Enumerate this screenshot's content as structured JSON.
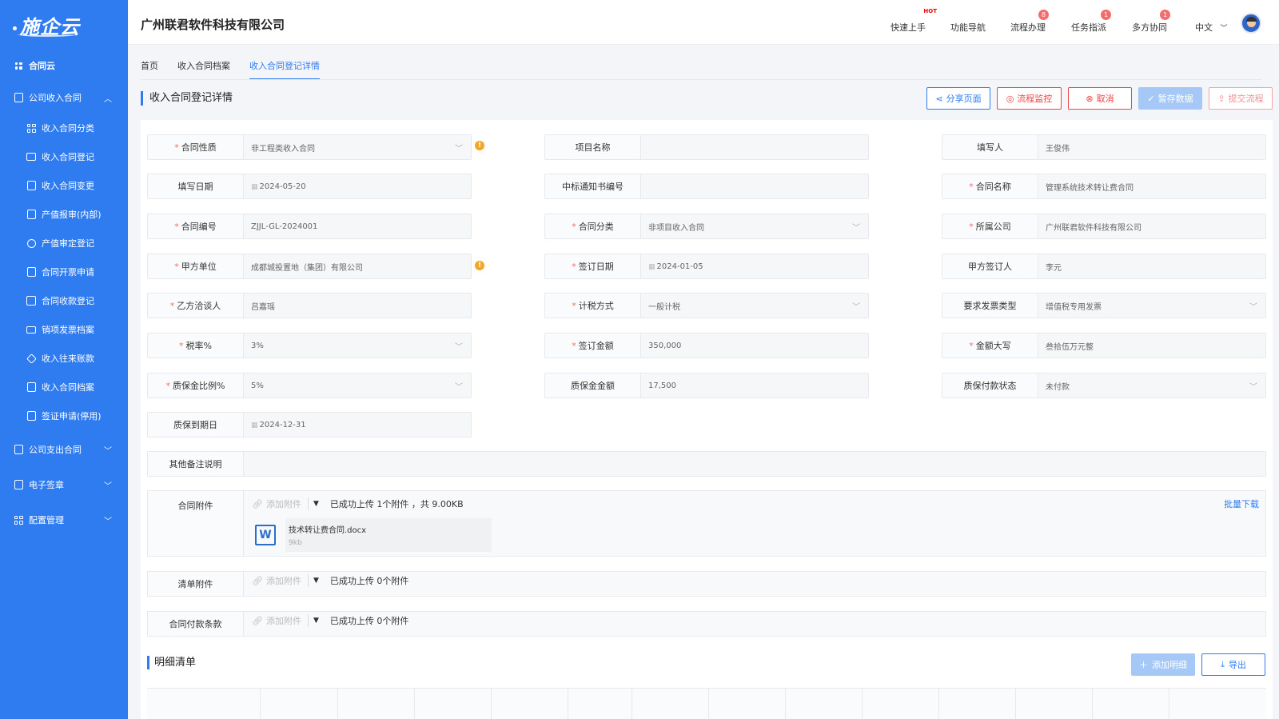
{
  "app": {
    "logo": "施企云",
    "company": "广州联君软件科技有限公司"
  },
  "sidebar": {
    "home": "合同云",
    "group1": "公司收入合同",
    "items": [
      {
        "label": "收入合同分类",
        "icon": "grid-icon"
      },
      {
        "label": "收入合同登记",
        "icon": "card-icon"
      },
      {
        "label": "收入合同变更",
        "icon": "doc-edit-icon"
      },
      {
        "label": "产值报审(内部)",
        "icon": "edit-icon"
      },
      {
        "label": "产值审定登记",
        "icon": "coin-icon"
      },
      {
        "label": "合同开票申请",
        "icon": "clipboard-icon"
      },
      {
        "label": "合同收款登记",
        "icon": "calendar-icon"
      },
      {
        "label": "销项发票档案",
        "icon": "ticket-icon"
      },
      {
        "label": "收入往来账款",
        "icon": "cube-icon"
      },
      {
        "label": "收入合同档案",
        "icon": "doc-icon"
      },
      {
        "label": "签证申请(停用)",
        "icon": "doc-edit-icon"
      }
    ],
    "group2": "公司支出合同",
    "group3": "电子签章",
    "group4": "配置管理"
  },
  "header": {
    "nav": [
      "快速上手",
      "功能导航",
      "流程办理",
      "任务指派",
      "多方协同"
    ],
    "hot": "HOT",
    "badges": {
      "flow": "8",
      "task": "1",
      "collab": "1"
    },
    "lang": "中文"
  },
  "tabs": [
    "首页",
    "收入合同档案",
    "收入合同登记详情"
  ],
  "page": {
    "title": "收入合同登记详情",
    "buttons": {
      "share": "分享页面",
      "monitor": "流程监控",
      "cancel": "取消",
      "save": "暂存数据",
      "submit": "提交流程"
    }
  },
  "form": {
    "f1": {
      "label": "合同性质",
      "value": "非工程类收入合同"
    },
    "f2": {
      "label": "项目名称",
      "value": ""
    },
    "f3": {
      "label": "填写人",
      "value": "王俊伟"
    },
    "f4": {
      "label": "填写日期",
      "value": "2024-05-20"
    },
    "f5": {
      "label": "中标通知书编号",
      "value": ""
    },
    "f6": {
      "label": "合同名称",
      "value": "管理系统技术转让费合同"
    },
    "f7": {
      "label": "合同编号",
      "value": "ZJJL-GL-2024001"
    },
    "f8": {
      "label": "合同分类",
      "value": "非项目收入合同"
    },
    "f9": {
      "label": "所属公司",
      "value": "广州联君软件科技有限公司"
    },
    "f10": {
      "label": "甲方单位",
      "value": "成都城投置地（集团）有限公司"
    },
    "f11": {
      "label": "签订日期",
      "value": "2024-01-05"
    },
    "f12": {
      "label": "甲方签订人",
      "value": "李元"
    },
    "f13": {
      "label": "乙方洽谈人",
      "value": "吕嘉瑶"
    },
    "f14": {
      "label": "计税方式",
      "value": "一般计税"
    },
    "f15": {
      "label": "要求发票类型",
      "value": "增值税专用发票"
    },
    "f16": {
      "label": "税率%",
      "value": "3%"
    },
    "f17": {
      "label": "签订金额",
      "value": "350,000"
    },
    "f18": {
      "label": "金额大写",
      "value": "叁拾伍万元整"
    },
    "f19": {
      "label": "质保金比例%",
      "value": "5%"
    },
    "f20": {
      "label": "质保金金额",
      "value": "17,500"
    },
    "f21": {
      "label": "质保付款状态",
      "value": "未付款"
    },
    "f22": {
      "label": "质保到期日",
      "value": "2024-12-31"
    },
    "f23": {
      "label": "其他备注说明",
      "value": ""
    }
  },
  "attachments": {
    "add": "添加附件",
    "contract": {
      "label": "合同附件",
      "info": "已成功上传 1个附件 ，共 9.00KB",
      "batch": "批量下载",
      "file_name": "技术转让费合同.docx",
      "file_size": "9kb"
    },
    "list": {
      "label": "清单附件",
      "info": "已成功上传 0个附件"
    },
    "terms": {
      "label": "合同付款条款",
      "info": "已成功上传 0个附件"
    }
  },
  "detail": {
    "title": "明细清单",
    "add": "添加明细",
    "export": "导出"
  }
}
